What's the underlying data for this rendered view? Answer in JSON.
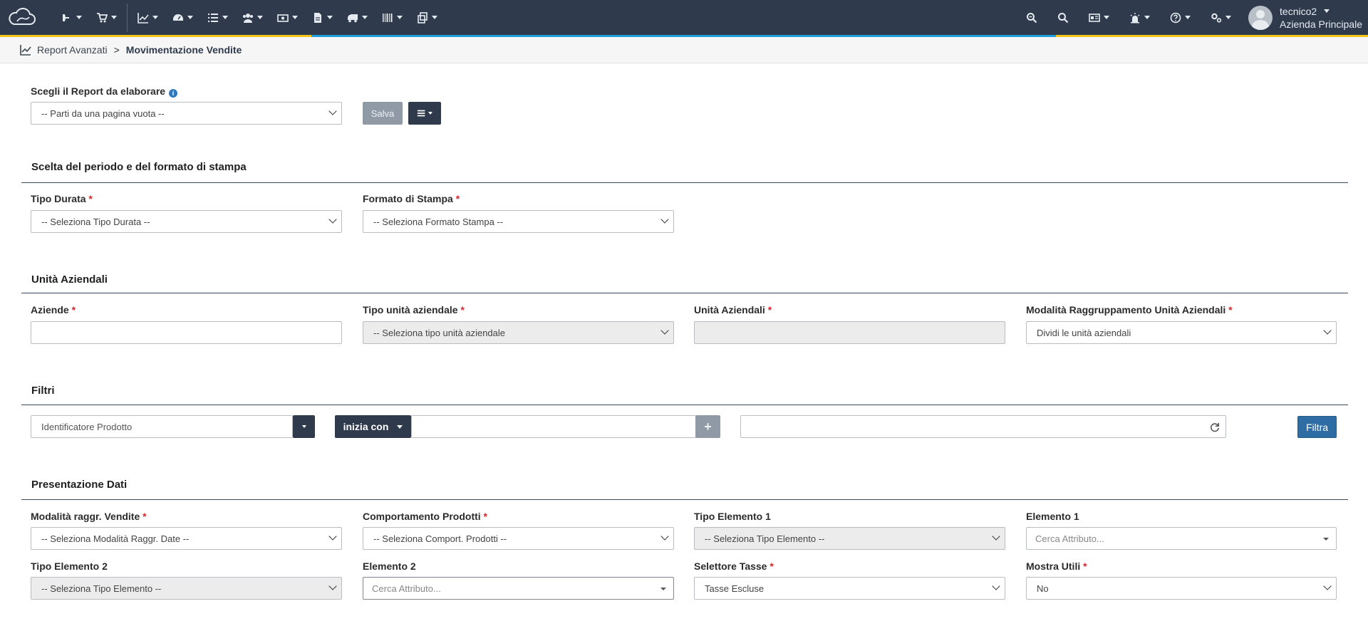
{
  "nav": {
    "left_icons": [
      "build-icon",
      "cart-icon",
      "chart-icon",
      "dashboard-icon",
      "list-icon",
      "users-icon",
      "money-icon",
      "document-icon",
      "truck-icon",
      "barcode-icon",
      "copy-icon"
    ],
    "right_icons": [
      "zoom-search-icon",
      "search-icon",
      "id-card-icon",
      "alarm-icon",
      "help-icon",
      "settings-icon"
    ],
    "user_name": "tecnico2",
    "company": "Azienda Principale"
  },
  "breadcrumb": {
    "parent": "Report Avanzati",
    "separator": ">",
    "current": "Movimentazione Vendite"
  },
  "report": {
    "label": "Scegli il Report da elaborare",
    "select_value": "-- Parti da una pagina vuota --",
    "save_label": "Salva"
  },
  "period": {
    "title": "Scelta del periodo e del formato di stampa",
    "tipo_durata_label": "Tipo Durata",
    "tipo_durata_value": "-- Seleziona Tipo Durata --",
    "formato_label": "Formato di Stampa",
    "formato_value": "-- Seleziona Formato Stampa --"
  },
  "units": {
    "title": "Unità Aziendali",
    "aziende_label": "Aziende",
    "aziende_value": "",
    "tipo_label": "Tipo unità aziendale",
    "tipo_value": "-- Seleziona tipo unità aziendale",
    "unita_label": "Unità Aziendali",
    "unita_value": "",
    "modalita_label": "Modalità Raggruppamento Unità Aziendali",
    "modalita_value": "Dividi le unità aziendali"
  },
  "filters": {
    "title": "Filtri",
    "field_value": "Identificatore Prodotto",
    "operator_label": "inizia con",
    "value_input": "",
    "second_input": "",
    "filter_button": "Filtra"
  },
  "presentation": {
    "title": "Presentazione Dati",
    "modalita_label": "Modalità raggr. Vendite",
    "modalita_value": "-- Seleziona Modalità Raggr. Date --",
    "comportamento_label": "Comportamento Prodotti",
    "comportamento_value": "-- Seleziona Comport. Prodotti --",
    "tipo1_label": "Tipo Elemento 1",
    "tipo1_value": "-- Seleziona Tipo Elemento --",
    "elemento1_label": "Elemento 1",
    "elemento1_placeholder": "Cerca Attributo...",
    "tipo2_label": "Tipo Elemento 2",
    "tipo2_value": "-- Seleziona Tipo Elemento --",
    "elemento2_label": "Elemento 2",
    "elemento2_placeholder": "Cerca Attributo...",
    "tasse_label": "Selettore Tasse",
    "tasse_value": "Tasse Escluse",
    "utili_label": "Mostra Utili",
    "utili_value": "No"
  },
  "required_mark": "*",
  "colors": {
    "navbar": "#2f3b4c",
    "accent_yellow": "#f5c51a",
    "accent_blue": "#1ea0dc",
    "required": "#d9262b",
    "primary_button": "#2e6da4"
  }
}
